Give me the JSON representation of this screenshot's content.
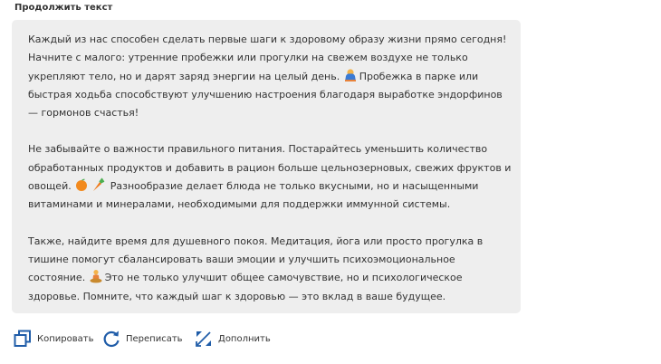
{
  "section": {
    "title": "Продолжить текст"
  },
  "message": {
    "paragraphs": [
      {
        "text_before": "Каждый из нас способен сделать первые шаги к здоровому образу жизни прямо сегодня! Начните с малого: утренние пробежки или прогулки на свежем воздухе не только укрепляют тело, но и дарят заряд энергии на целый день.",
        "emojis": [
          "runner-emoji"
        ],
        "text_after": "Пробежка в парке или быстрая ходьба способствуют улучшению настроения благодаря выработке эндорфинов — гормонов счастья!"
      },
      {
        "text_before": "Не забывайте о важности правильного питания. Постарайтесь уменьшить количество обработанных продуктов и добавить в рацион больше цельнозерновых, свежих фруктов и овощей.",
        "emojis": [
          "orange-emoji",
          "carrot-emoji"
        ],
        "text_after": "Разнообразие делает блюда не только вкусными, но и насыщенными витаминами и минералами, необходимыми для поддержки иммунной системы."
      },
      {
        "text_before": "Также, найдите время для душевного покоя. Медитация, йога или просто прогулка в тишине помогут сбалансировать ваши эмоции и улучшить психоэмоциональное состояние.",
        "emojis": [
          "meditation-emoji"
        ],
        "text_after": "Это не только улучшит общее самочувствие, но и психологическое здоровье. Помните, что каждый шаг к здоровью — это вклад в ваше будущее."
      }
    ]
  },
  "actions": {
    "copy": {
      "label": "Копировать",
      "icon": "copy-icon"
    },
    "rewrite": {
      "label": "Переписать",
      "icon": "refresh-icon"
    },
    "extend": {
      "label": "Дополнить",
      "icon": "expand-icon"
    }
  },
  "colors": {
    "accent": "#1f5ca8",
    "bubble": "#eeeeee",
    "text": "#333333"
  }
}
